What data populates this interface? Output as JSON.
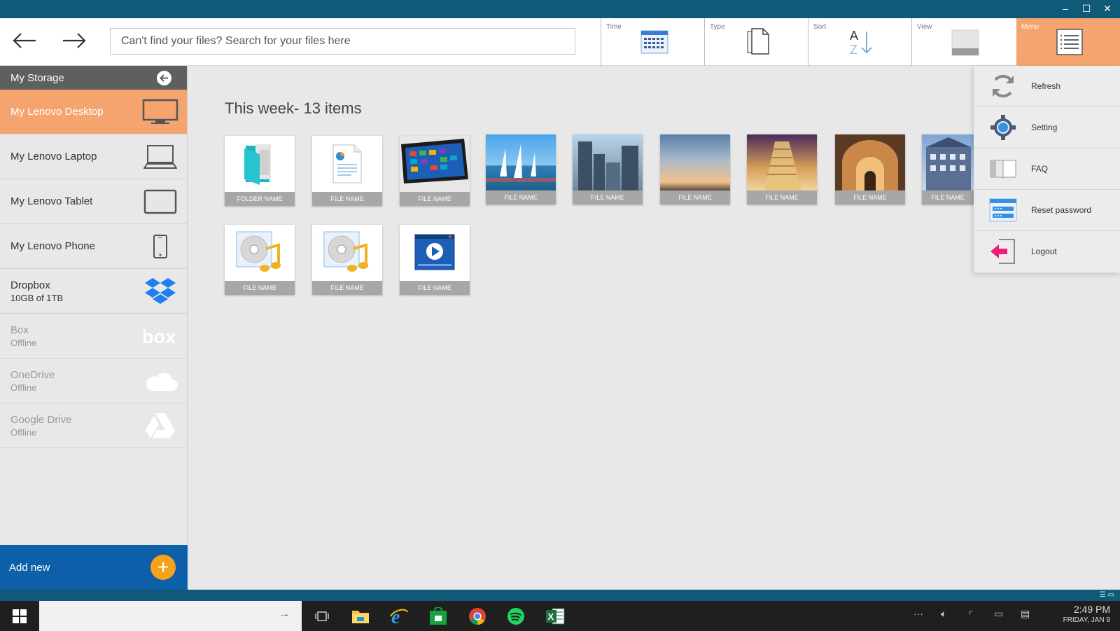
{
  "window": {
    "controls": [
      "–",
      "☐",
      "✕"
    ]
  },
  "toolbar": {
    "back_icon": "arrow-left-icon",
    "forward_icon": "arrow-right-icon",
    "search_placeholder": "Can't find your files? Search for your files here",
    "tools": [
      {
        "label": "Time",
        "icon": "calendar-icon"
      },
      {
        "label": "Type",
        "icon": "documents-icon"
      },
      {
        "label": "Sort",
        "icon": "sort-az-icon"
      },
      {
        "label": "View",
        "icon": "view-icon"
      },
      {
        "label": "Menu",
        "icon": "list-icon"
      }
    ]
  },
  "sidebar": {
    "header": "My Storage",
    "items": [
      {
        "name": "My Lenovo Desktop",
        "sub": "",
        "icon": "desktop-icon",
        "active": true
      },
      {
        "name": "My Lenovo Laptop",
        "sub": "",
        "icon": "laptop-icon"
      },
      {
        "name": "My Lenovo Tablet",
        "sub": "",
        "icon": "tablet-icon"
      },
      {
        "name": "My Lenovo Phone",
        "sub": "",
        "icon": "phone-icon"
      },
      {
        "name": "Dropbox",
        "sub": "10GB of 1TB",
        "icon": "dropbox-icon"
      },
      {
        "name": "Box",
        "sub": "Offline",
        "icon": "box-icon",
        "offline": true
      },
      {
        "name": "OneDrive",
        "sub": "Offline",
        "icon": "cloud-icon",
        "offline": true
      },
      {
        "name": "Google Drive",
        "sub": "Offline",
        "icon": "google-drive-icon",
        "offline": true
      }
    ],
    "add_new": "Add new"
  },
  "main": {
    "section_title": "This week- 13 items",
    "items": [
      {
        "caption": "FOLDER NAME",
        "kind": "folder"
      },
      {
        "caption": "FILE NAME",
        "kind": "document"
      },
      {
        "caption": "FILE NAME",
        "kind": "tablet-photo"
      },
      {
        "caption": "FILE NAME",
        "kind": "photo"
      },
      {
        "caption": "FILE NAME",
        "kind": "photo"
      },
      {
        "caption": "FILE NAME",
        "kind": "photo"
      },
      {
        "caption": "FILE NAME",
        "kind": "photo"
      },
      {
        "caption": "FILE NAME",
        "kind": "photo"
      },
      {
        "caption": "FILE NAME",
        "kind": "photo"
      },
      {
        "caption": "FILE NAME",
        "kind": "music"
      },
      {
        "caption": "FILE NAME",
        "kind": "music"
      },
      {
        "caption": "FILE NAME",
        "kind": "video"
      }
    ]
  },
  "menu": {
    "items": [
      {
        "label": "Refresh",
        "icon": "refresh-icon"
      },
      {
        "label": "Setting",
        "icon": "gear-icon"
      },
      {
        "label": "FAQ",
        "icon": "book-icon"
      },
      {
        "label": "Reset password",
        "icon": "password-icon"
      },
      {
        "label": "Logout",
        "icon": "logout-icon"
      }
    ]
  },
  "taskbar": {
    "time": "2:49 PM",
    "date": "FRIDAY, JAN 9",
    "apps": [
      "task-view-icon",
      "file-explorer-icon",
      "internet-explorer-icon",
      "store-icon",
      "chrome-icon",
      "spotify-icon",
      "excel-icon"
    ]
  },
  "colors": {
    "accent": "#f5a46f",
    "titlebar": "#0e5a78",
    "add_new": "#0c5fa8",
    "plus": "#f7a21b"
  }
}
